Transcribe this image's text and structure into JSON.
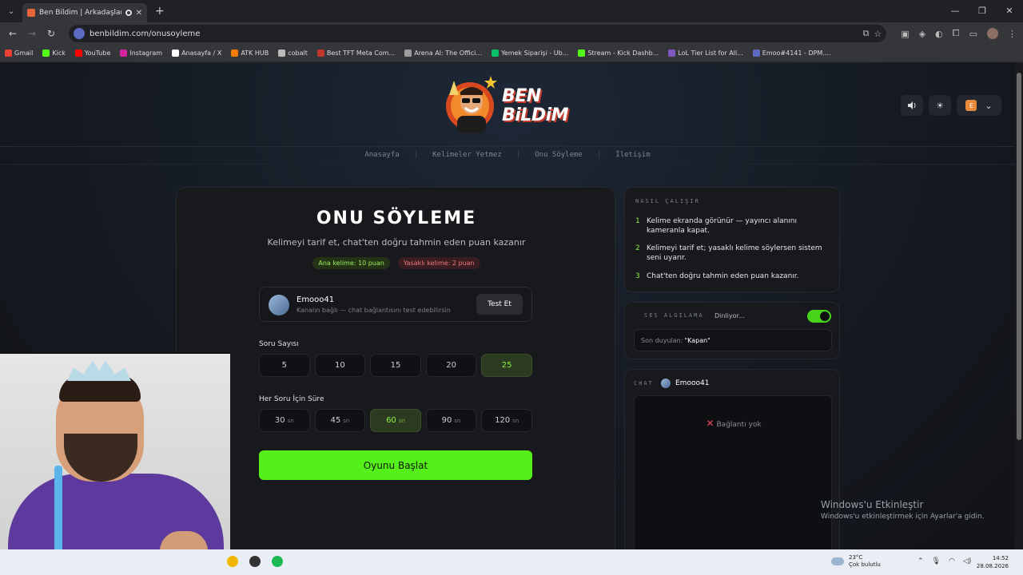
{
  "browser": {
    "tab_title": "Ben Bildim | Arkadaşlarınla",
    "url": "benbildim.com/onusoyleme",
    "bookmarks": [
      {
        "label": "Gmail",
        "color": "#ea4335"
      },
      {
        "label": "Kick",
        "color": "#53fc18"
      },
      {
        "label": "YouTube",
        "color": "#ff0000"
      },
      {
        "label": "Instagram",
        "color": "#d6249f"
      },
      {
        "label": "Anasayfa / X",
        "color": "#ffffff"
      },
      {
        "label": "ATK HUB",
        "color": "#f57c00"
      },
      {
        "label": "cobalt",
        "color": "#bbbbbb"
      },
      {
        "label": "Best TFT Meta Com...",
        "color": "#c0392b"
      },
      {
        "label": "Arena AI: The Offici...",
        "color": "#9e9e9e"
      },
      {
        "label": "Yemek Siparişi - Ub...",
        "color": "#06c167"
      },
      {
        "label": "Stream - Kick Dashb...",
        "color": "#53fc18"
      },
      {
        "label": "LoL Tier List for All...",
        "color": "#7e57c2"
      },
      {
        "label": "Emoo#4141 - DPM....",
        "color": "#5c6bc0"
      }
    ]
  },
  "site": {
    "logo_line1": "BEN",
    "logo_line2": "BiLDiM",
    "user_initial": "E",
    "menu": [
      "Anasayfa",
      "Kelimeler Yetmez",
      "Onu Söyleme",
      "İletişim"
    ]
  },
  "game": {
    "title": "ONU SÖYLEME",
    "subtitle": "Kelimeyi tarif et, chat'ten doğru tahmin eden puan kazanır",
    "main_points": "Ana kelime: 10 puan",
    "forbidden_points": "Yasaklı kelime: 2 puan",
    "channel_name": "Emooo41",
    "channel_status": "Kanalın bağlı — chat bağlantısını test edebilirsin",
    "test_button": "Test Et",
    "question_label": "Soru Sayısı",
    "question_options": [
      "5",
      "10",
      "15",
      "20",
      "25"
    ],
    "question_selected": "25",
    "time_label": "Her Soru İçin Süre",
    "time_options": [
      "30",
      "45",
      "60",
      "90",
      "120"
    ],
    "time_unit": "sn",
    "time_selected": "60",
    "start_button": "Oyunu Başlat"
  },
  "how": {
    "title": "NASIL ÇALIŞIR",
    "steps": [
      {
        "n": "1",
        "text": "Kelime ekranda görünür — yayıncı alanını kameranla kapat."
      },
      {
        "n": "2",
        "text": "Kelimeyi tarif et; yasaklı kelime söylersen sistem seni uyarır."
      },
      {
        "n": "3",
        "text": "Chat'ten doğru tahmin eden puan kazanır."
      }
    ]
  },
  "voice": {
    "title": "SES ALGILAMA",
    "state": "Dinliyor...",
    "heard_label": "Son duyulan:",
    "heard_value": "\"Kapan\"",
    "enabled": true
  },
  "chat": {
    "title": "CHAT",
    "user": "Emooo41",
    "status": "Bağlantı yok"
  },
  "windows": {
    "activate_title": "Windows'u Etkinleştir",
    "activate_sub": "Windows'u etkinleştirmek için Ayarlar'a gidin.",
    "weather_temp": "23°C",
    "weather_desc": "Çok bulutlu",
    "time": "14:52",
    "date": "28.08.2026"
  }
}
